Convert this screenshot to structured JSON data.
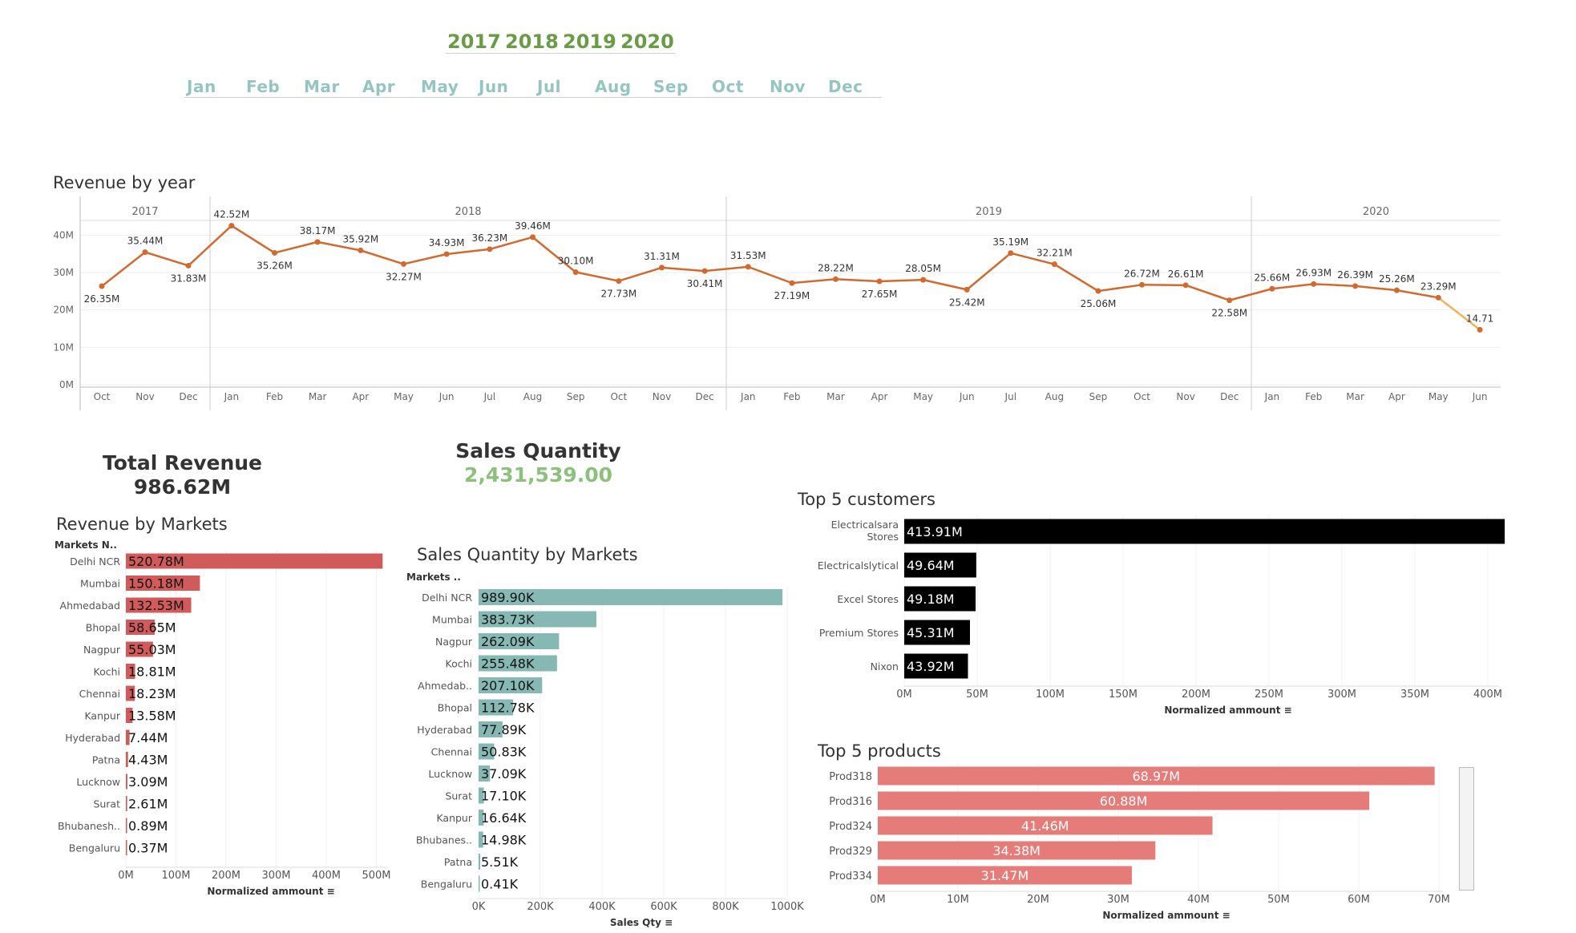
{
  "colors": {
    "year_filter": "#6a9b46",
    "month_filter": "#95c5c2",
    "line": "#d2692e",
    "line_end": "#f0b35a",
    "rev_market_bar": "#d15b5b",
    "qty_market_bar": "#86b9b4",
    "customer_bar": "#000000",
    "product_bar": "#e57c79",
    "kpi_green": "#8bc17d"
  },
  "filters": {
    "years": [
      "2017",
      "2018",
      "2019",
      "2020"
    ],
    "months": [
      "Jan",
      "Feb",
      "Mar",
      "Apr",
      "May",
      "Jun",
      "Jul",
      "Aug",
      "Sep",
      "Oct",
      "Nov",
      "Dec"
    ]
  },
  "kpis": {
    "total_revenue_label": "Total Revenue",
    "total_revenue_value": "986.62M",
    "sales_qty_label": "Sales Quantity",
    "sales_qty_value": "2,431,539.00"
  },
  "chart_data": [
    {
      "type": "line",
      "title": "Revenue by year",
      "panels": [
        {
          "year": "2017",
          "months": [
            "Oct",
            "Nov",
            "Dec"
          ],
          "values": [
            26.35,
            35.44,
            31.83
          ],
          "labels": [
            "26.35M",
            "35.44M",
            "31.83M"
          ]
        },
        {
          "year": "2018",
          "months": [
            "Jan",
            "Feb",
            "Mar",
            "Apr",
            "May",
            "Jun",
            "Jul",
            "Aug",
            "Sep",
            "Oct",
            "Nov",
            "Dec"
          ],
          "values": [
            42.52,
            35.26,
            38.17,
            35.92,
            32.27,
            34.93,
            36.23,
            39.46,
            30.1,
            27.73,
            31.31,
            30.41
          ],
          "labels": [
            "42.52M",
            "35.26M",
            "38.17M",
            "35.92M",
            "32.27M",
            "34.93M",
            "36.23M",
            "39.46M",
            "30.10M",
            "27.73M",
            "31.31M",
            "30.41M"
          ]
        },
        {
          "year": "2019",
          "months": [
            "Jan",
            "Feb",
            "Mar",
            "Apr",
            "May",
            "Jun",
            "Jul",
            "Aug",
            "Sep",
            "Oct",
            "Nov",
            "Dec"
          ],
          "values": [
            31.53,
            27.19,
            28.22,
            27.65,
            28.05,
            25.42,
            35.19,
            32.21,
            25.06,
            26.72,
            26.61,
            22.58
          ],
          "labels": [
            "31.53M",
            "27.19M",
            "28.22M",
            "27.65M",
            "28.05M",
            "25.42M",
            "35.19M",
            "32.21M",
            "25.06M",
            "26.72M",
            "26.61M",
            "22.58M"
          ]
        },
        {
          "year": "2020",
          "months": [
            "Jan",
            "Feb",
            "Mar",
            "Apr",
            "May",
            "Jun"
          ],
          "values": [
            25.66,
            26.93,
            26.39,
            25.26,
            23.29,
            14.71
          ],
          "labels": [
            "25.66M",
            "26.93M",
            "26.39M",
            "25.26M",
            "23.29M",
            "14.71"
          ]
        }
      ],
      "y_ticks": [
        "0M",
        "10M",
        "20M",
        "30M",
        "40M"
      ],
      "ylim": [
        0,
        45
      ],
      "grid": true
    },
    {
      "type": "bar",
      "orientation": "horizontal",
      "title": "Revenue by Markets",
      "category_header": "Markets N..",
      "categories": [
        "Delhi NCR",
        "Mumbai",
        "Ahmedabad",
        "Bhopal",
        "Nagpur",
        "Kochi",
        "Chennai",
        "Kanpur",
        "Hyderabad",
        "Patna",
        "Lucknow",
        "Surat",
        "Bhubanesh..",
        "Bengaluru"
      ],
      "values": [
        520.78,
        150.18,
        132.53,
        58.65,
        55.03,
        18.81,
        18.23,
        13.58,
        7.44,
        4.43,
        3.09,
        2.61,
        0.89,
        0.37
      ],
      "labels": [
        "520.78M",
        "150.18M",
        "132.53M",
        "58.65M",
        "55.03M",
        "18.81M",
        "18.23M",
        "13.58M",
        "7.44M",
        "4.43M",
        "3.09M",
        "2.61M",
        "0.89M",
        "0.37M"
      ],
      "x_ticks": [
        "0M",
        "100M",
        "200M",
        "300M",
        "400M",
        "500M"
      ],
      "xlim": [
        0,
        530
      ],
      "xlabel": "Normalized ammount"
    },
    {
      "type": "bar",
      "orientation": "horizontal",
      "title": "Sales Quantity by Markets",
      "category_header": "Markets ..",
      "categories": [
        "Delhi NCR",
        "Mumbai",
        "Nagpur",
        "Kochi",
        "Ahmedab..",
        "Bhopal",
        "Hyderabad",
        "Chennai",
        "Lucknow",
        "Surat",
        "Kanpur",
        "Bhubanes..",
        "Patna",
        "Bengaluru"
      ],
      "values": [
        989.9,
        383.73,
        262.09,
        255.48,
        207.1,
        112.78,
        77.89,
        50.83,
        37.09,
        17.1,
        16.64,
        14.98,
        5.51,
        0.41
      ],
      "labels": [
        "989.90K",
        "383.73K",
        "262.09K",
        "255.48K",
        "207.10K",
        "112.78K",
        "77.89K",
        "50.83K",
        "37.09K",
        "17.10K",
        "16.64K",
        "14.98K",
        "5.51K",
        "0.41K"
      ],
      "x_ticks": [
        "0K",
        "200K",
        "400K",
        "600K",
        "800K",
        "1000K"
      ],
      "xlim": [
        0,
        1000
      ],
      "xlabel": "Sales Qty"
    },
    {
      "type": "bar",
      "orientation": "horizontal",
      "title": "Top 5 customers",
      "categories": [
        "Electricalsara Stores",
        "Electricalslytical",
        "Excel Stores",
        "Premium Stores",
        "Nixon"
      ],
      "values": [
        413.91,
        49.64,
        49.18,
        45.31,
        43.92
      ],
      "labels": [
        "413.91M",
        "49.64M",
        "49.18M",
        "45.31M",
        "43.92M"
      ],
      "x_ticks": [
        "0M",
        "50M",
        "100M",
        "150M",
        "200M",
        "250M",
        "300M",
        "350M",
        "400M"
      ],
      "xlim": [
        0,
        410
      ],
      "xlabel": "Normalized ammount"
    },
    {
      "type": "bar",
      "orientation": "horizontal",
      "title": "Top 5 products",
      "categories": [
        "Prod318",
        "Prod316",
        "Prod324",
        "Prod329",
        "Prod334"
      ],
      "values": [
        68.97,
        60.88,
        41.46,
        34.38,
        31.47
      ],
      "labels": [
        "68.97M",
        "60.88M",
        "41.46M",
        "34.38M",
        "31.47M"
      ],
      "x_ticks": [
        "0M",
        "10M",
        "20M",
        "30M",
        "40M",
        "50M",
        "60M",
        "70M"
      ],
      "xlim": [
        0,
        70
      ],
      "xlabel": "Normalized ammount"
    }
  ]
}
